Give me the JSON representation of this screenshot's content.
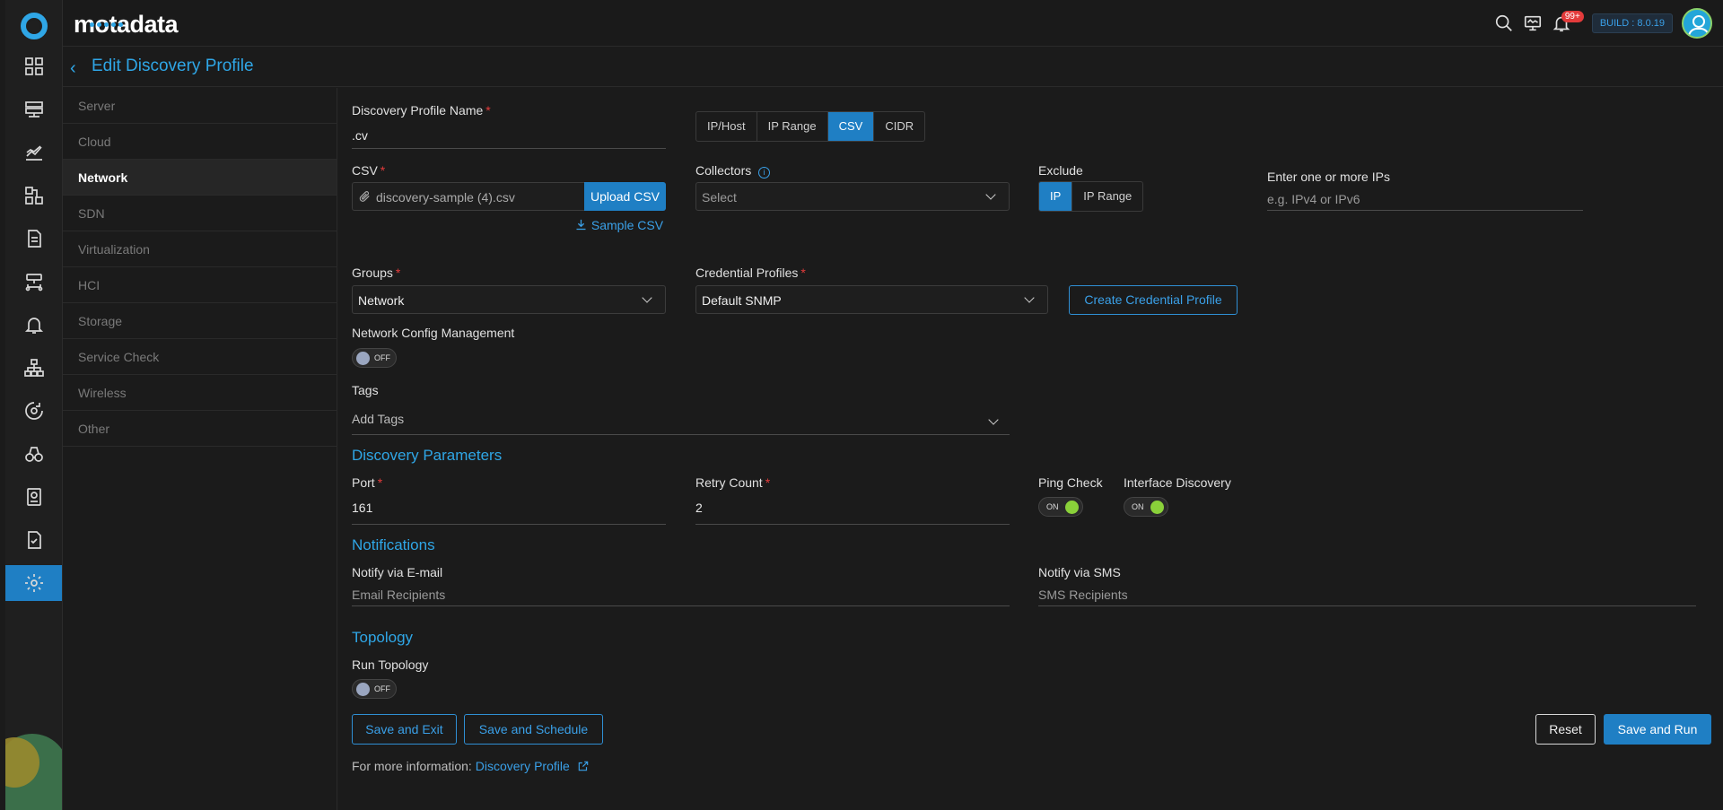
{
  "app": {
    "brand": "motadata",
    "build": "BUILD : 8.0.19",
    "notification_count": "99+"
  },
  "rail": {
    "items": [
      "dashboard-icon",
      "server-icon",
      "metrics-icon",
      "topology-icon",
      "report-icon",
      "network-icon",
      "alert-icon",
      "hierarchy-icon",
      "monitor-cog-icon",
      "binoculars-icon",
      "audit-icon",
      "checklist-icon",
      "settings-icon"
    ],
    "active": "settings-icon"
  },
  "header": {
    "title": "Edit Discovery Profile"
  },
  "categories": [
    "Server",
    "Cloud",
    "Network",
    "SDN",
    "Virtualization",
    "HCI",
    "Storage",
    "Service Check",
    "Wireless",
    "Other"
  ],
  "active_category": "Network",
  "form": {
    "profile_name": {
      "label": "Discovery Profile Name",
      "value": ".cv"
    },
    "type_tabs": [
      "IP/Host",
      "IP Range",
      "CSV",
      "CIDR"
    ],
    "active_type": "CSV",
    "csv": {
      "label": "CSV",
      "file": "discovery-sample (4).csv",
      "upload_label": "Upload CSV",
      "sample_label": "Sample CSV"
    },
    "collectors": {
      "label": "Collectors",
      "placeholder": "Select"
    },
    "exclude": {
      "label": "Exclude",
      "tabs": [
        "IP",
        "IP Range"
      ],
      "active": "IP"
    },
    "ips": {
      "label": "Enter one or more IPs",
      "placeholder": "e.g. IPv4 or IPv6"
    },
    "groups": {
      "label": "Groups",
      "value": "Network"
    },
    "credential_profiles": {
      "label": "Credential Profiles",
      "value": "Default SNMP",
      "create_label": "Create Credential Profile"
    },
    "ncm": {
      "label": "Network Config Management",
      "state": "OFF"
    },
    "tags": {
      "label": "Tags",
      "placeholder": "Add Tags"
    },
    "discovery_parameters": {
      "title": "Discovery Parameters",
      "port": {
        "label": "Port",
        "value": "161"
      },
      "retry": {
        "label": "Retry Count",
        "value": "2"
      },
      "ping": {
        "label": "Ping Check",
        "state": "ON"
      },
      "interface": {
        "label": "Interface Discovery",
        "state": "ON"
      }
    },
    "notifications": {
      "title": "Notifications",
      "email": {
        "label": "Notify via E-mail",
        "placeholder": "Email Recipients"
      },
      "sms": {
        "label": "Notify via SMS",
        "placeholder": "SMS Recipients"
      }
    },
    "topology": {
      "title": "Topology",
      "run_label": "Run Topology",
      "state": "OFF"
    },
    "buttons": {
      "save_exit": "Save and Exit",
      "save_schedule": "Save and Schedule",
      "reset": "Reset",
      "save_run": "Save and Run"
    },
    "footer": {
      "prefix": "For more information:",
      "link": "Discovery Profile"
    }
  },
  "colors": {
    "accent": "#1f7fc4",
    "link": "#2fa6e6",
    "required": "#e33b3b",
    "toggle_on": "#8ad13a"
  }
}
